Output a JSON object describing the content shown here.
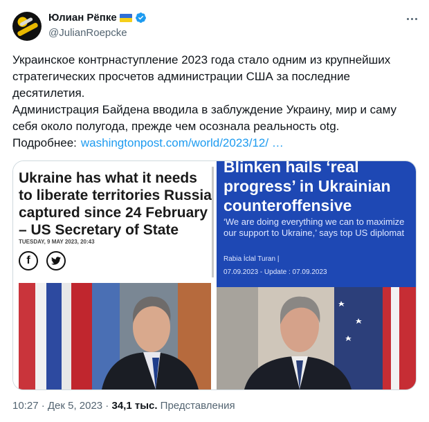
{
  "author": {
    "name": "Юлиан Рёпке",
    "handle": "@JulianRoepcke"
  },
  "tweet": {
    "paragraph1": "Украинское контрнаступление 2023 года стало одним из крупнейших стратегических просчетов администрации США за последние десятилетия.",
    "paragraph2": "Администрация Байдена вводила в заблуждение Украину, мир и саму себя около полугода, прежде чем осознала реальность otg.",
    "more_label": "Подробнее:",
    "link_text": "washingtonpost.com/world/2023/12/ …"
  },
  "media": {
    "left": {
      "headline": "Ukraine has what it needs to liberate territories Russia captured since 24 February – US Secretary of State",
      "dateline": "TUESDAY, 9 MAY 2023, 20:43",
      "social": [
        "f",
        "t"
      ]
    },
    "right": {
      "headline": "Blinken hails ‘real progress’ in Ukrainian counteroffensive",
      "subtitle": "‘We are doing everything we can to maximize our support to Ukraine,’ says top US diplomat",
      "author": "Rabia İclal Turan  |",
      "dates": "07.09.2023 - Update : 07.09.2023"
    }
  },
  "footer": {
    "time": "10:27 · Дек 5, 2023 · ",
    "views_count": "34,1 тыс.",
    "views_label": " Представления"
  },
  "colors": {
    "link": "#1d9bf0",
    "verified": "#1d9bf0",
    "right_card_bg": "#1e48b4"
  }
}
